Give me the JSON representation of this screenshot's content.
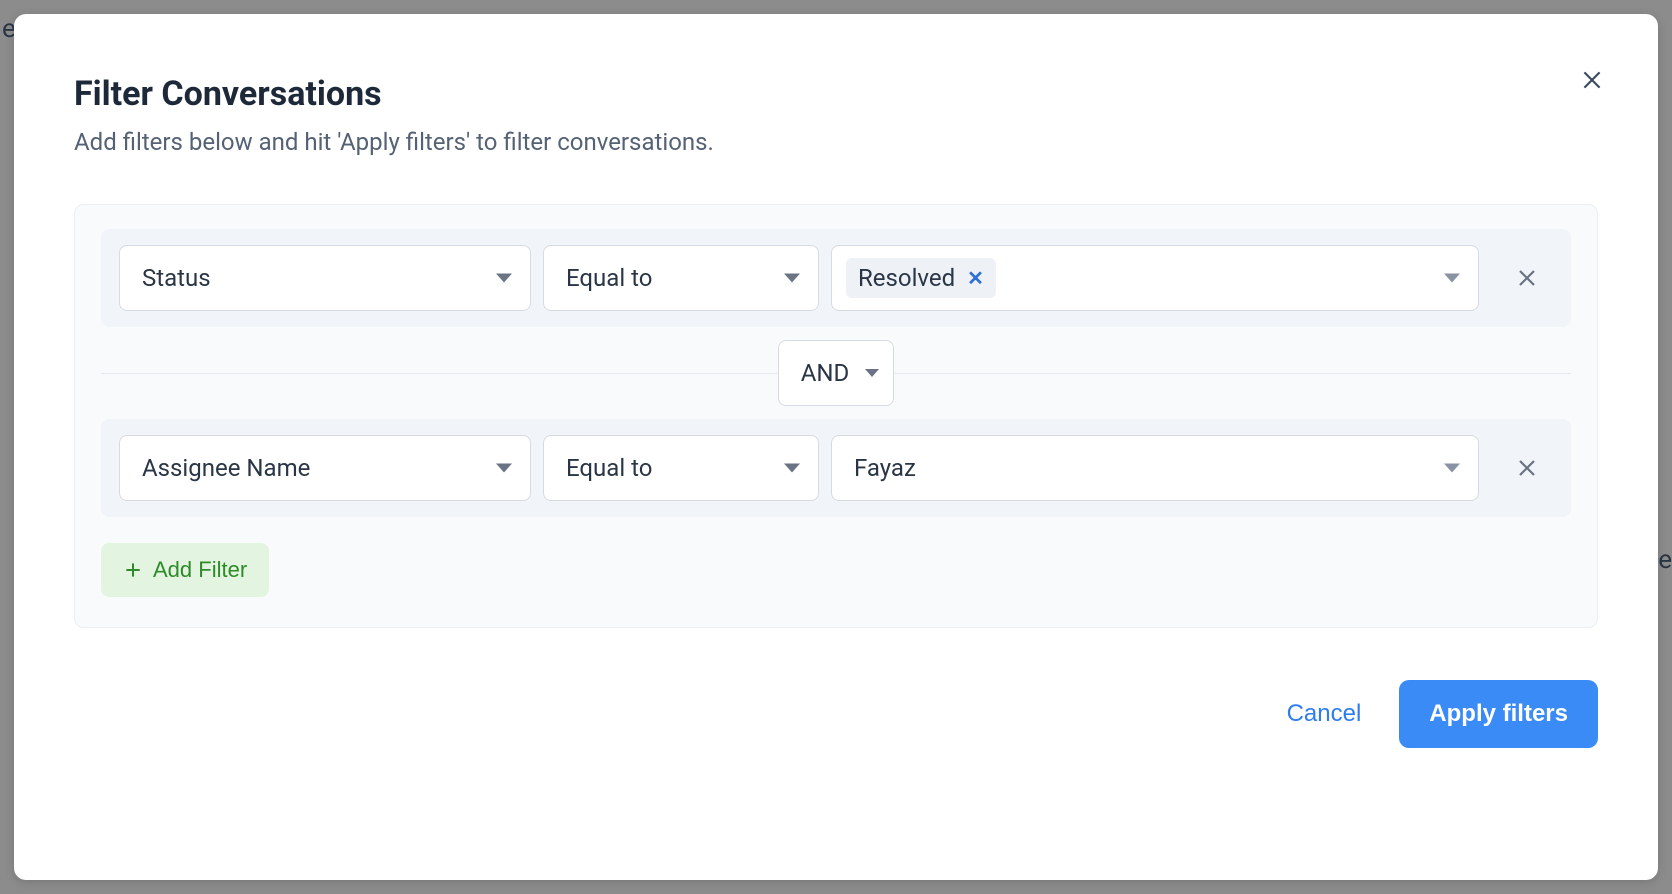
{
  "dialog": {
    "title": "Filter Conversations",
    "subtitle": "Add filters below and hit 'Apply filters' to filter conversations."
  },
  "filters": [
    {
      "field": "Status",
      "operator": "Equal to",
      "value": "Resolved",
      "value_as_chip": true
    },
    {
      "field": "Assignee Name",
      "operator": "Equal to",
      "value": "Fayaz",
      "value_as_chip": false
    }
  ],
  "connector": "AND",
  "buttons": {
    "add_filter": "Add Filter",
    "cancel": "Cancel",
    "apply": "Apply filters"
  },
  "bg_text": {
    "left": "e",
    "right": "ne"
  }
}
